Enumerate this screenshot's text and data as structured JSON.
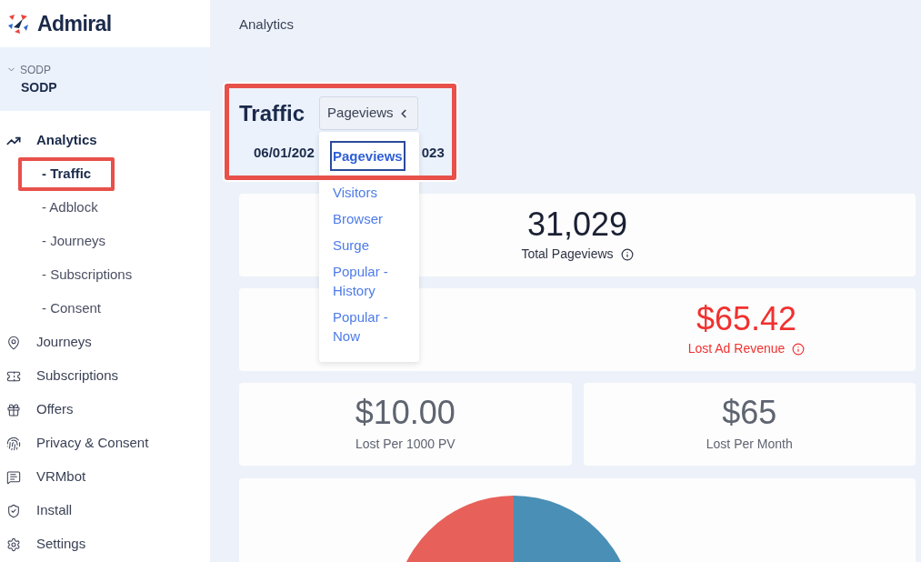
{
  "brand": {
    "name": "Admiral"
  },
  "workspace": {
    "label": "SODP",
    "name": "SODP",
    "expanded": true
  },
  "nav": [
    {
      "label": "Analytics",
      "selected": true,
      "expanded": true,
      "children": [
        {
          "label": "- Traffic",
          "selected": true
        },
        {
          "label": "- Adblock",
          "selected": false
        },
        {
          "label": "- Journeys",
          "selected": false
        },
        {
          "label": "- Subscriptions",
          "selected": false
        },
        {
          "label": "- Consent",
          "selected": false
        }
      ]
    },
    {
      "label": "Journeys",
      "selected": false
    },
    {
      "label": "Subscriptions",
      "selected": false
    },
    {
      "label": "Offers",
      "selected": false
    },
    {
      "label": "Privacy & Consent",
      "selected": false
    },
    {
      "label": "VRMbot",
      "selected": false
    },
    {
      "label": "Install",
      "selected": false
    },
    {
      "label": "Settings",
      "selected": false
    }
  ],
  "breadcrumb": "Analytics",
  "header": {
    "title": "Traffic",
    "date_start": "06/01/202",
    "date_end": "023",
    "metric_select": {
      "value": "Pageviews",
      "expanded": true,
      "options": [
        {
          "label": "Pageviews",
          "selected": true
        },
        {
          "label": "Visitors",
          "selected": false
        },
        {
          "label": "Browser",
          "selected": false
        },
        {
          "label": "Surge",
          "selected": false
        },
        {
          "label": "Popular - History",
          "selected": false
        },
        {
          "label": "Popular - Now",
          "selected": false
        }
      ]
    }
  },
  "total": {
    "value": "31,029",
    "label": "Total Pageviews"
  },
  "lost_revenue": {
    "value": "$65.42",
    "label": "Lost Ad Revenue"
  },
  "small_stats": [
    {
      "value": "$10.00",
      "label": "Lost Per 1000 PV"
    },
    {
      "value": "$65",
      "label": "Lost Per Month"
    }
  ]
}
